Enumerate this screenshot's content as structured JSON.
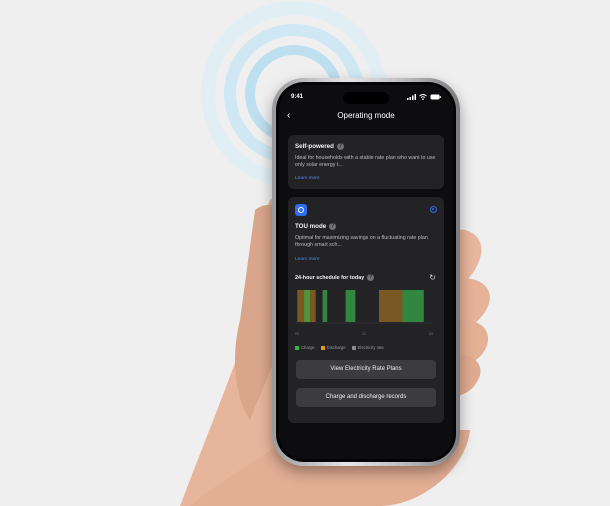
{
  "status_bar": {
    "time": "9:41"
  },
  "nav": {
    "back_label": "‹",
    "title": "Operating mode"
  },
  "self_powered": {
    "title": "Self-powered",
    "description": "Ideal for households with a stable rate plan who want to use only solar energy t...",
    "link": "Learn more"
  },
  "tou": {
    "title": "TOU mode",
    "description": "Optimal for maximizing savings on a fluctuating rate plan through smart sch...",
    "link": "Learn more",
    "selected": true,
    "schedule_title": "24-hour schedule for today",
    "schedule_subtitle": "…",
    "legend": [
      {
        "label": "Charge",
        "color": "#38b24a"
      },
      {
        "label": "Discharge",
        "color": "#e39a24"
      },
      {
        "label": "Electricity rate",
        "color": "#8a8a8e"
      }
    ],
    "buttons": {
      "rate_plans": "View Electricity Rate Plans",
      "records": "Charge and discharge records"
    }
  },
  "colors": {
    "accent": "#2f6df0",
    "charge": "#38b24a",
    "discharge": "#e39a24"
  },
  "chart_data": {
    "type": "bar",
    "xlabel": "",
    "ylabel": "",
    "x_ticks": [
      "00",
      "12",
      "24"
    ],
    "series": [
      {
        "name": "Discharge",
        "segments": [
          [
            0.4,
            3.6
          ],
          [
            14.6,
            18.7
          ]
        ]
      },
      {
        "name": "Charge",
        "segments": [
          [
            1.6,
            2.6
          ],
          [
            4.8,
            5.6
          ],
          [
            8.8,
            10.5
          ],
          [
            18.7,
            22.4
          ]
        ]
      }
    ]
  }
}
